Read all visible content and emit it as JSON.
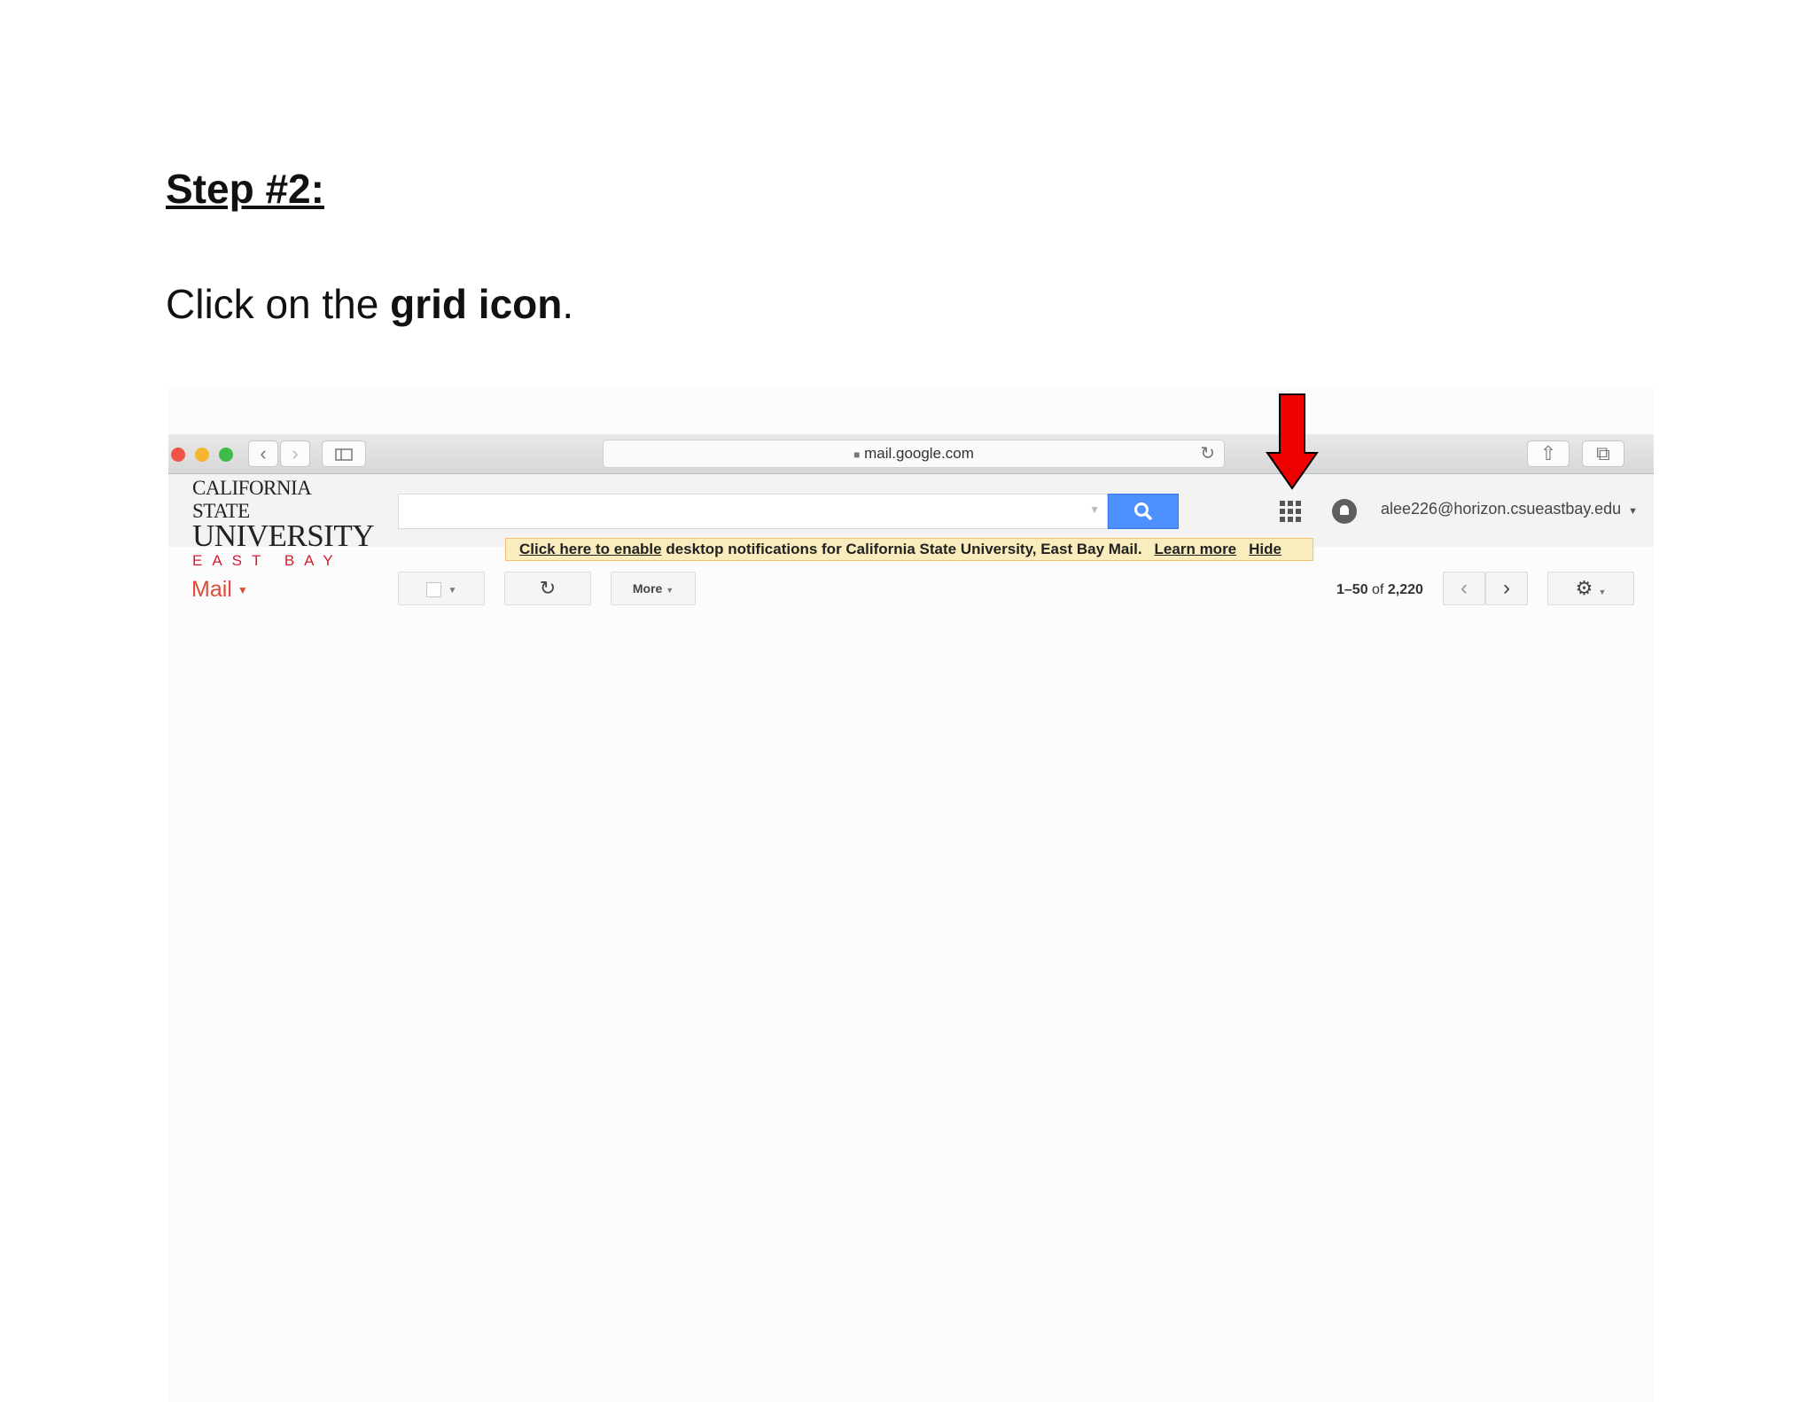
{
  "doc": {
    "step_title": "Step #2:",
    "instruction_prefix": "Click on the ",
    "instruction_bold": "grid icon",
    "instruction_suffix": "."
  },
  "browser": {
    "url": "mail.google.com",
    "back_icon": "chevron-left-icon",
    "forward_icon": "chevron-right-icon",
    "sidebar_icon": "sidebar-icon",
    "reload_icon": "reload-icon",
    "share_icon": "share-icon",
    "tabs_icon": "tabs-icon",
    "lock_icon": "lock-icon"
  },
  "logo": {
    "line1": "CALIFORNIA STATE",
    "line2": "UNIVERSITY",
    "line3": "EAST BAY",
    "accent": "#d31b2f"
  },
  "header": {
    "search_placeholder": "",
    "search_icon": "search-icon",
    "apps_icon": "grid-icon",
    "notifications_icon": "bell-icon",
    "account": "alee226@horizon.csueastbay.edu",
    "search_button_color": "#4d90fe"
  },
  "notification": {
    "link1": "Click here to enable",
    "text": " desktop notifications for California State University, East Bay Mail.",
    "learn_more": "Learn more",
    "hide": "Hide"
  },
  "toolbar": {
    "mail_label": "Mail",
    "more_label": "More",
    "pager_range": "1–50",
    "pager_of": "of",
    "pager_total": "2,220",
    "prev_icon": "chevron-left-icon",
    "next_icon": "chevron-right-icon",
    "settings_icon": "gear-icon",
    "refresh_icon": "refresh-icon"
  },
  "annotation": {
    "arrow_color": "#ee0000"
  }
}
